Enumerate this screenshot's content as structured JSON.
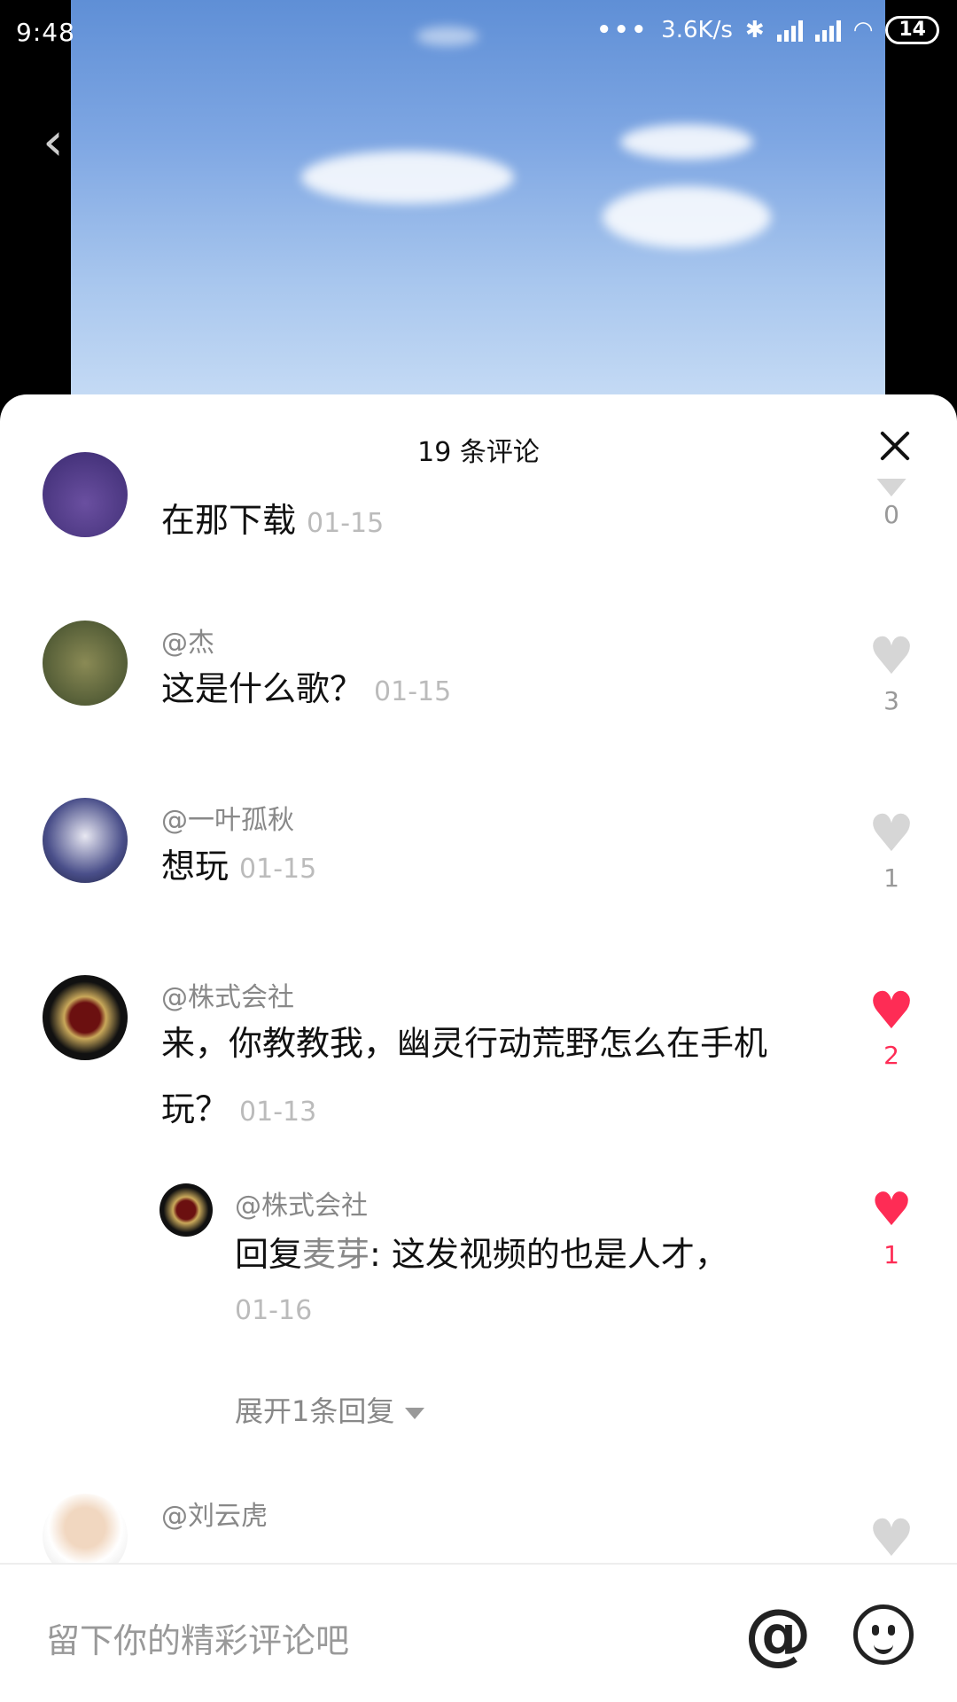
{
  "status": {
    "time": "9:48",
    "speed": "3.6K/s",
    "battery": "14"
  },
  "sheet": {
    "title": "19 条评论"
  },
  "comments": [
    {
      "text": "在那下载",
      "date": "01-15",
      "likes": "0"
    },
    {
      "user": "@杰",
      "text": "这是什么歌？",
      "date": "01-15",
      "likes": "3"
    },
    {
      "user": "@一叶孤秋",
      "text": "想玩",
      "date": "01-15",
      "likes": "1"
    },
    {
      "user": "@株式会社",
      "text": "来，你教教我，幽灵行动荒野怎么在手机玩？",
      "date": "01-13",
      "likes": "2"
    },
    {
      "user": "@刘云虎"
    }
  ],
  "reply": {
    "user": "@株式会社",
    "prefix": "回复",
    "to": "麦芽",
    "text": ": 这发视频的也是人才，",
    "date": "01-16",
    "likes": "1"
  },
  "expand_label": "展开1条回复",
  "input": {
    "placeholder": "留下你的精彩评论吧"
  },
  "colors": {
    "accent": "#fe2c55",
    "inactive_heart": "#d6d6d6"
  },
  "icons": [
    "back-icon",
    "close-icon",
    "heart-icon",
    "at-icon",
    "emoji-icon",
    "bluetooth-icon",
    "wifi-icon",
    "signal-icon",
    "battery-icon"
  ]
}
